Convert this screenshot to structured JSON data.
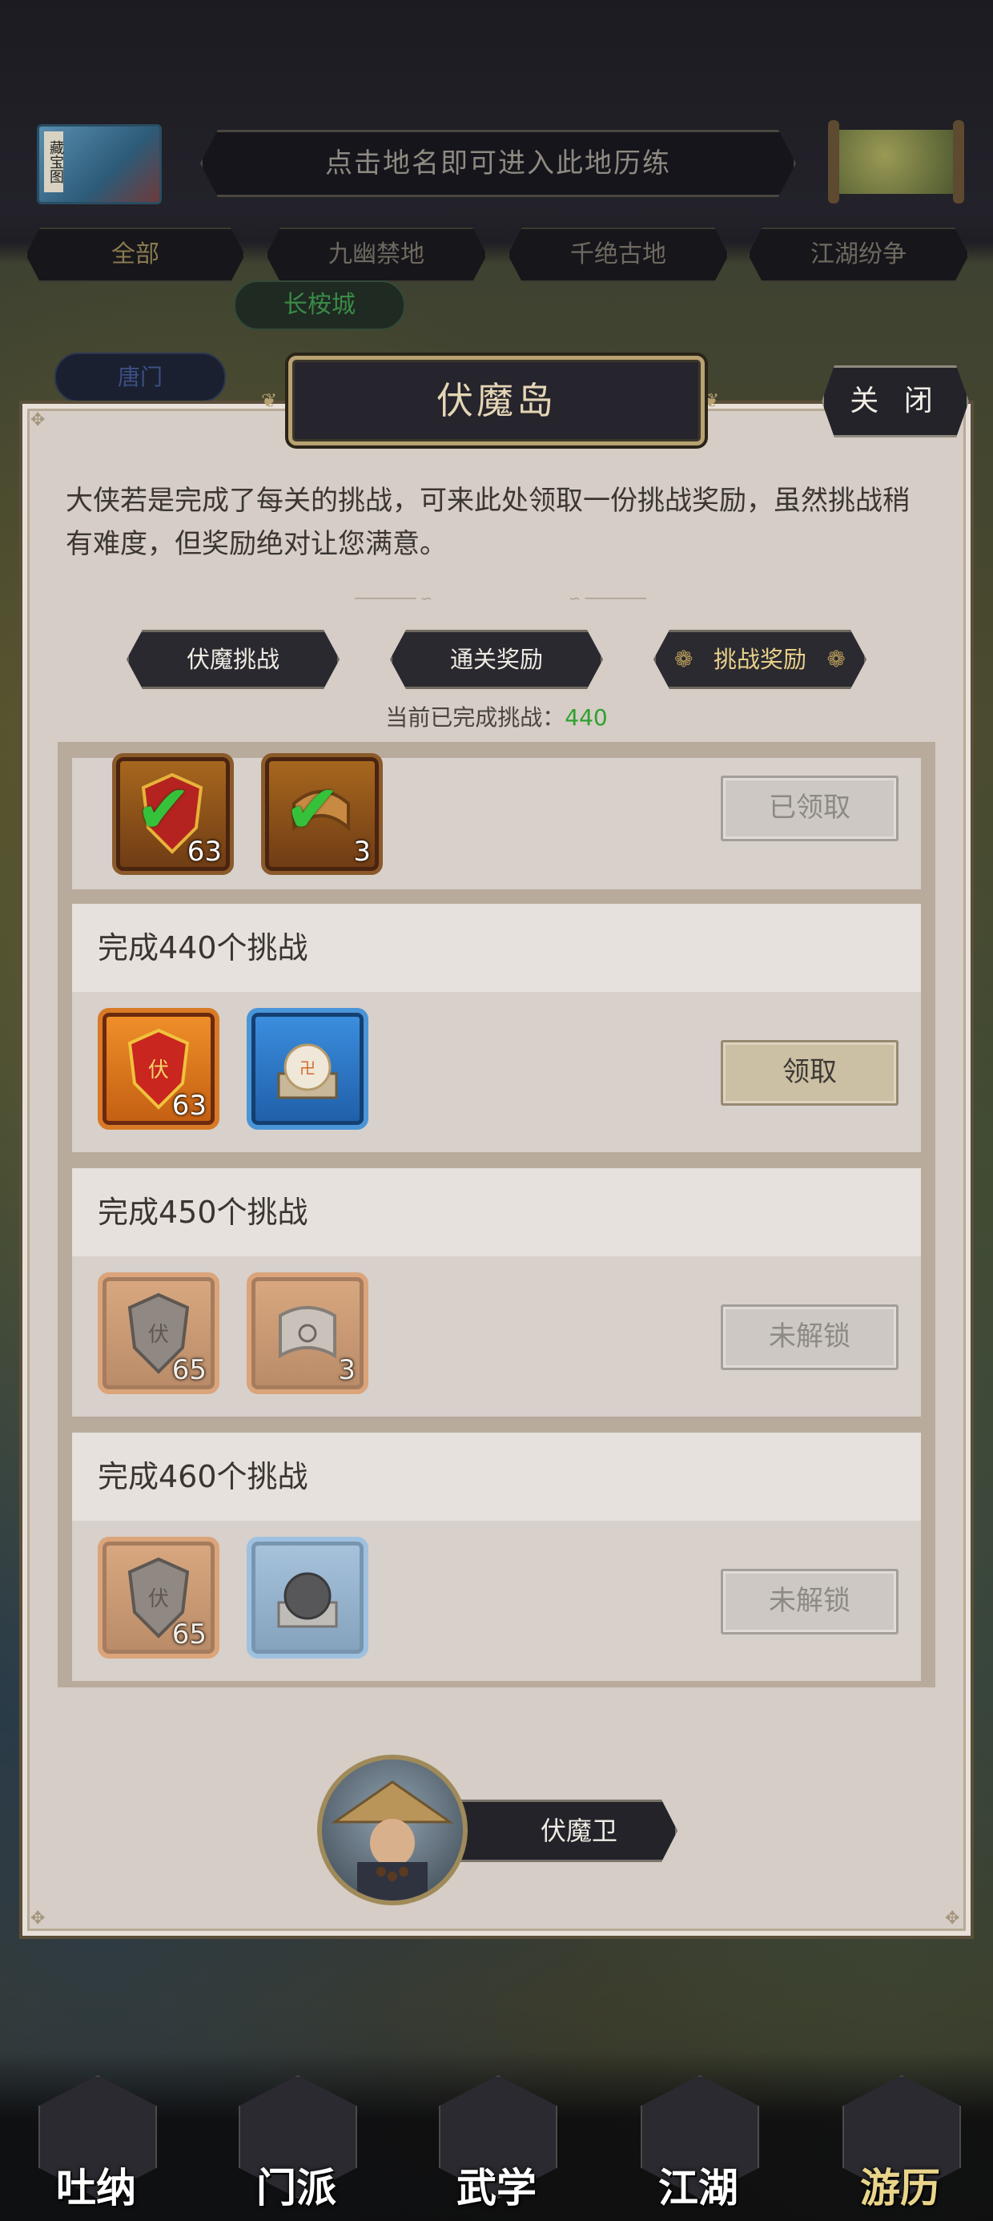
{
  "top": {
    "scroll_text": "藏宝图",
    "hint": "点击地名即可进入此地历练",
    "tabs": [
      "全部",
      "九幽禁地",
      "千绝古地",
      "江湖纷争"
    ],
    "city": "长桉城",
    "tangmen": "唐门"
  },
  "dialog": {
    "title": "伏魔岛",
    "close_label": "关 闭",
    "description": "大侠若是完成了每关的挑战，可来此处领取一份挑战奖励，虽然挑战稍有难度，但奖励绝对让您满意。",
    "tabs": [
      {
        "label": "伏魔挑战",
        "active": false
      },
      {
        "label": "通关奖励",
        "active": false
      },
      {
        "label": "挑战奖励",
        "active": true
      }
    ],
    "progress_label": "当前已完成挑战：",
    "progress_value": "440",
    "rewards": [
      {
        "title": "",
        "items": [
          {
            "icon": "red-shield-token-icon",
            "count": "63",
            "claimed": true
          },
          {
            "icon": "scroll-token-icon",
            "count": "3",
            "claimed": true
          }
        ],
        "button": "已领取",
        "state": "claimed"
      },
      {
        "title": "完成440个挑战",
        "items": [
          {
            "icon": "red-shield-token-icon",
            "count": "63"
          },
          {
            "icon": "pearl-orb-icon",
            "count": ""
          }
        ],
        "button": "领取",
        "state": "claimable"
      },
      {
        "title": "完成450个挑战",
        "items": [
          {
            "icon": "shield-token-icon",
            "count": "65"
          },
          {
            "icon": "scroll-token-icon",
            "count": "3"
          }
        ],
        "button": "未解锁",
        "state": "locked"
      },
      {
        "title": "完成460个挑战",
        "items": [
          {
            "icon": "shield-token-icon",
            "count": "65"
          },
          {
            "icon": "orb-icon",
            "count": ""
          }
        ],
        "button": "未解锁",
        "state": "locked"
      }
    ],
    "npc_name": "伏魔卫"
  },
  "nav": [
    {
      "label": "吐纳",
      "icon": "meditation-icon",
      "active": false
    },
    {
      "label": "门派",
      "icon": "sect-flags-icon",
      "active": false
    },
    {
      "label": "武学",
      "icon": "books-icon",
      "active": false
    },
    {
      "label": "江湖",
      "icon": "bamboo-hat-icon",
      "active": false
    },
    {
      "label": "游历",
      "icon": "horse-icon",
      "active": true
    }
  ],
  "colors": {
    "progress_green": "#2fa12f",
    "active_tab_text": "#e8d08a",
    "title_text": "#e4d6b5"
  }
}
